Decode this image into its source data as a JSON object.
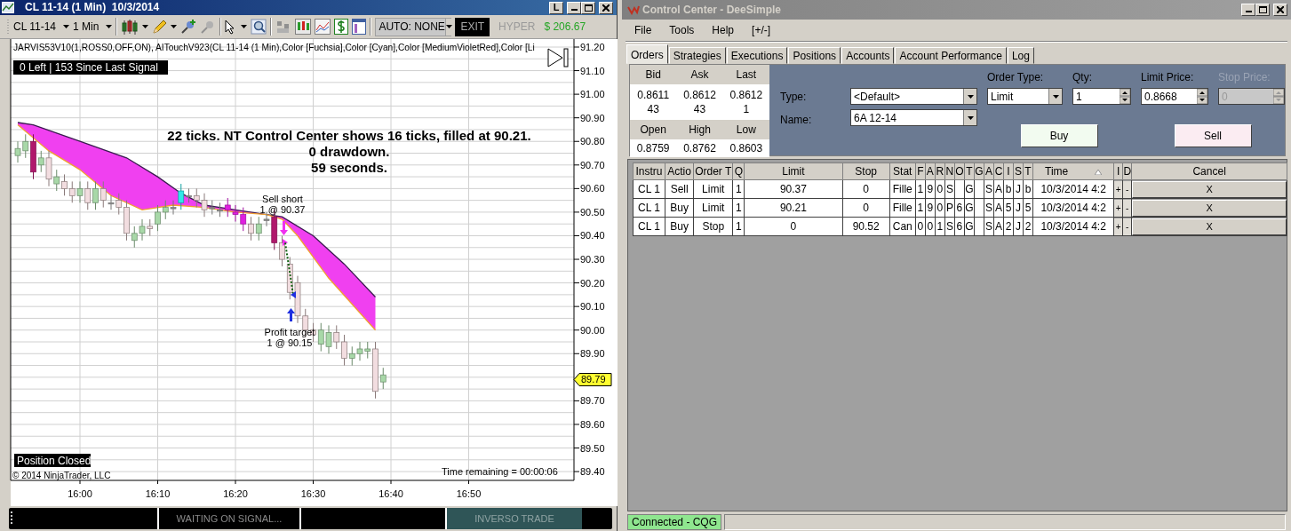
{
  "chart_window": {
    "title": "CL 11-14 (1 Min)  10/3/2014",
    "title_button": "L",
    "toolbar": {
      "instrument": "CL 11-14",
      "interval": "1 Min",
      "auto_mode": "AUTO: NONE",
      "exit_button": "EXIT",
      "hyper_button": "HYPER",
      "pnl": "$ 206.67"
    },
    "indicator_legend": "JARVIS53V10(1,ROSS0,OFF,ON),  AITouchV923(CL 11-14 (1 Min),Color [Fuchsia],Color [Cyan],Color [MediumVioletRed],Color [Li",
    "signal_counter": "0 Left | 153 Since Last Signal",
    "annotation_lines": [
      "22 ticks. NT Control Center shows 16 ticks, filled at 90.21.",
      "0 drawdown.",
      "59 seconds."
    ],
    "trade_markers": [
      {
        "kind": "entry",
        "lines": [
          "Sell short",
          "1 @ 90.37"
        ]
      },
      {
        "kind": "exit",
        "lines": [
          "Profit target",
          "1 @ 90.15"
        ]
      }
    ],
    "price_axis": [
      "91.20",
      "91.10",
      "91.00",
      "90.90",
      "90.80",
      "90.70",
      "90.60",
      "90.50",
      "90.40",
      "90.30",
      "90.20",
      "90.10",
      "90.00",
      "89.90"
    ],
    "price_axis_lower": [
      "89.70",
      "89.60",
      "89.50",
      "89.40"
    ],
    "last_price": "89.79",
    "time_axis": [
      "16:00",
      "16:10",
      "16:20",
      "16:30",
      "16:40",
      "16:50"
    ],
    "position_label": "Position Closed",
    "copyright": "© 2014 NinjaTrader, LLC",
    "time_remaining": "Time remaining = 00:00:06",
    "status_strip": [
      {
        "kind": "plain",
        "text": "WAITING ON SIGNAL..."
      },
      {
        "kind": "highlight",
        "text": "INVERSO TRADE"
      }
    ]
  },
  "control_center": {
    "title": "Control Center - DeeSimple",
    "menu": [
      "File",
      "Tools",
      "Help",
      "[+/-]"
    ],
    "tabs": [
      {
        "label": "Orders",
        "selected": true
      },
      {
        "label": "Strategies",
        "selected": false
      },
      {
        "label": "Executions",
        "selected": false
      },
      {
        "label": "Positions",
        "selected": false
      },
      {
        "label": "Accounts",
        "selected": false
      },
      {
        "label": "Account Performance",
        "selected": false
      },
      {
        "label": "Log",
        "selected": false
      }
    ],
    "quote": {
      "headers": [
        "Bid",
        "Ask",
        "Last"
      ],
      "prices": [
        "0.8611",
        "0.8612",
        "0.8612"
      ],
      "sizes": [
        "43",
        "43",
        "1"
      ],
      "session_headers": [
        "Open",
        "High",
        "Low"
      ],
      "session_values": [
        "0.8759",
        "0.8762",
        "0.8603"
      ]
    },
    "order_entry": {
      "type_label": "Type:",
      "type_value": "<Default>",
      "name_label": "Name:",
      "name_value": "6A 12-14",
      "fields": [
        {
          "kind": "select",
          "label": "Order Type:",
          "value": "Limit",
          "disabled": false
        },
        {
          "kind": "spinner",
          "label": "Qty:",
          "value": "1",
          "disabled": false
        },
        {
          "kind": "spinner",
          "label": "Limit Price:",
          "value": "0.8668",
          "disabled": false
        },
        {
          "kind": "spinner",
          "label": "Stop Price:",
          "value": "0",
          "disabled": true
        }
      ],
      "buy_button": "Buy",
      "sell_button": "Sell"
    },
    "orders_table": {
      "columns": [
        {
          "label": "Instru",
          "kind": "text"
        },
        {
          "label": "Actio",
          "kind": "text"
        },
        {
          "label": "Order T",
          "kind": "text"
        },
        {
          "label": "Q",
          "kind": "text"
        },
        {
          "label": "Limit",
          "kind": "text"
        },
        {
          "label": "Stop",
          "kind": "text"
        },
        {
          "label": "Stat",
          "kind": "text"
        },
        {
          "label": "F",
          "kind": "text"
        },
        {
          "label": "A",
          "kind": "text"
        },
        {
          "label": "R",
          "kind": "text"
        },
        {
          "label": "N",
          "kind": "text"
        },
        {
          "label": "O",
          "kind": "text"
        },
        {
          "label": "T",
          "kind": "text"
        },
        {
          "label": "G",
          "kind": "text"
        },
        {
          "label": "A",
          "kind": "text"
        },
        {
          "label": "C",
          "kind": "text"
        },
        {
          "label": "I",
          "kind": "text"
        },
        {
          "label": "S",
          "kind": "text"
        },
        {
          "label": "T",
          "kind": "text"
        },
        {
          "label": "Time",
          "kind": "text",
          "sorted": true
        },
        {
          "label": "I",
          "kind": "button"
        },
        {
          "label": "D",
          "kind": "button"
        },
        {
          "label": "Cancel",
          "kind": "wide_button"
        }
      ],
      "rows": [
        {
          "cells": [
            "CL 1",
            "Sell",
            "Limit",
            "1",
            "90.37",
            "0",
            "Fille",
            "1",
            "9",
            "0",
            "S",
            null,
            "G",
            null,
            "S",
            "A",
            "b",
            "J",
            "b",
            "10/3/2014 4:2",
            "+",
            "-",
            "X"
          ]
        },
        {
          "cells": [
            "CL 1",
            "Buy",
            "Limit",
            "1",
            "90.21",
            "0",
            "Fille",
            "1",
            "9",
            "0",
            "P",
            "6",
            "G",
            null,
            "S",
            "A",
            "5",
            "J",
            "5",
            "10/3/2014 4:2",
            "+",
            "-",
            "X"
          ]
        },
        {
          "cells": [
            "CL 1",
            "Buy",
            "Stop",
            "1",
            "0",
            "90.52",
            "Can",
            "0",
            "0",
            "1",
            "S",
            "6",
            "G",
            null,
            "S",
            "A",
            "2",
            "J",
            "2",
            "10/3/2014 4:2",
            "+",
            "-",
            "X"
          ]
        }
      ]
    },
    "status_bar": {
      "connection": "Connected - CQG",
      "connected": true
    }
  }
}
